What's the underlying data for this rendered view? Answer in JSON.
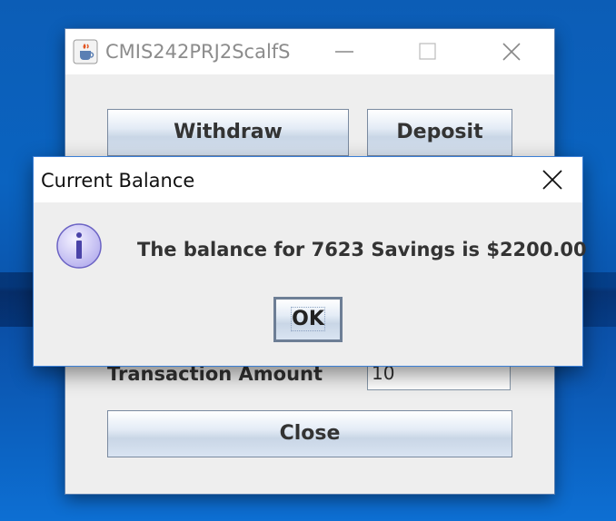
{
  "main_window": {
    "title": "CMIS242PRJ2ScalfS",
    "buttons": {
      "withdraw": "Withdraw",
      "deposit": "Deposit",
      "close": "Close"
    },
    "transaction_amount": {
      "label": "Transaction Amount",
      "value": "10"
    }
  },
  "dialog": {
    "title": "Current Balance",
    "message": "The balance for 7623 Savings is $2200.00",
    "ok_label": "OK",
    "icon": "information-icon"
  },
  "icons": {
    "app": "java-cup-icon",
    "minimize": "minimize-icon",
    "maximize": "maximize-icon",
    "close": "close-icon"
  },
  "colors": {
    "desktop": "#0a63c0",
    "window_bg": "#eeeeee",
    "dialog_border": "#3b7fd6"
  }
}
